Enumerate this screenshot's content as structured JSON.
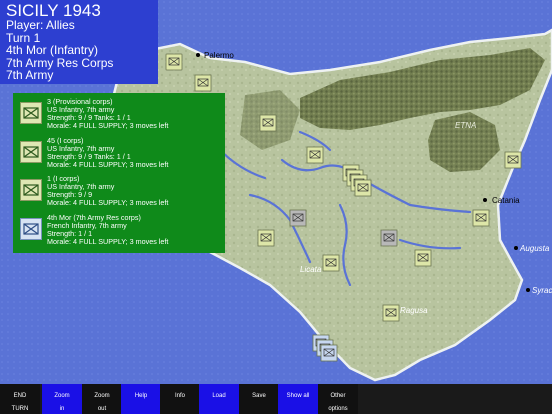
{
  "header": {
    "title": "SICILY 1943",
    "player": "Player: Allies",
    "turn": "Turn 1",
    "unit": "4th Mor (Infantry)",
    "corps": "7th Army Res Corps",
    "army": "7th Army"
  },
  "units": [
    {
      "name": "3 (Provisional corps)",
      "type": "US Infantry, 7th army",
      "strength": "Strength: 9 / 9  Tanks: 1 / 1",
      "status": "Morale: 4  FULL SUPPLY; 3 moves left",
      "icon": "infantry-icon"
    },
    {
      "name": "45 (I corps)",
      "type": "US Infantry, 7th army",
      "strength": "Strength: 9 / 9  Tanks: 1 / 1",
      "status": "Morale: 4  FULL SUPPLY; 3 moves left",
      "icon": "infantry-icon"
    },
    {
      "name": "1 (I corps)",
      "type": "US Infantry, 7th army",
      "strength": "Strength: 9 / 9",
      "status": "Morale: 4  FULL SUPPLY; 3 moves left",
      "icon": "infantry-icon"
    },
    {
      "name": "4th Mor (7th Army Res corps)",
      "type": "French Infantry, 7th army",
      "strength": "Strength: 1 / 1",
      "status": "Morale: 4  FULL SUPPLY; 3 moves left",
      "icon": "french-infantry-icon"
    }
  ],
  "map": {
    "labels": {
      "palermo": "Palermo",
      "etna": "ETNA",
      "catania": "Catania",
      "augusta": "Augusta",
      "licata": "Licata",
      "ragusa": "Ragusa",
      "syracuse": "Syrac"
    },
    "colors": {
      "sea": "#5a73d6",
      "land": "#b9c6a3",
      "mountain": "#6f7a4f",
      "river": "#5a73d6",
      "coast": "#e8edf0"
    }
  },
  "toolbar": [
    {
      "l1": "END",
      "l2": "TURN",
      "style": "black"
    },
    {
      "l1": "Zoom",
      "l2": "in",
      "style": "blue"
    },
    {
      "l1": "Zoom",
      "l2": "out",
      "style": "black"
    },
    {
      "l1": "Help",
      "l2": "",
      "style": "blue"
    },
    {
      "l1": "Info",
      "l2": "",
      "style": "black"
    },
    {
      "l1": "Load",
      "l2": "",
      "style": "blue"
    },
    {
      "l1": "Save",
      "l2": "",
      "style": "black"
    },
    {
      "l1": "Show all",
      "l2": "",
      "style": "blue"
    },
    {
      "l1": "Other",
      "l2": "options",
      "style": "black"
    }
  ]
}
